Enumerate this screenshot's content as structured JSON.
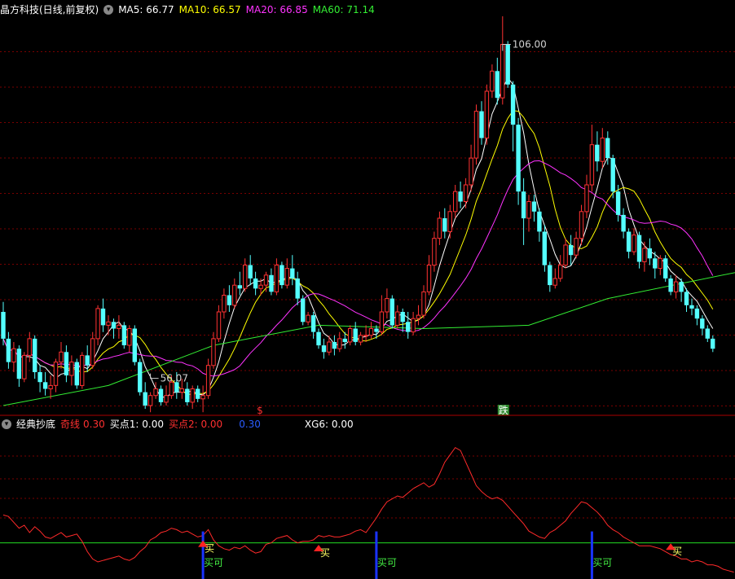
{
  "top": {
    "title": "晶方科技(日线,前复权)",
    "indicators": [
      {
        "label": "MA5: 66.77",
        "color": "#ffffff"
      },
      {
        "label": "MA10: 66.57",
        "color": "#ffff00"
      },
      {
        "label": "MA20: 66.85",
        "color": "#ff33ff"
      },
      {
        "label": "MA60: 71.14",
        "color": "#33ee33"
      }
    ]
  },
  "bottom": {
    "title": "经典抄底",
    "indicators": [
      {
        "label": "奇线",
        "color": "#ff3030"
      },
      {
        "label": "0.30",
        "color": "#ff3030"
      },
      {
        "label": "买点1: 0.00",
        "color": "#ffffff"
      },
      {
        "label": "买点2: 0.00",
        "color": "#ff3030"
      },
      {
        "label": "0.30",
        "color": "#2a5cff"
      },
      {
        "label": "XG6: 0.00",
        "color": "#ffffff"
      }
    ]
  },
  "chart_data": [
    {
      "type": "candlestick",
      "high_label": "106.00",
      "low_label": "56.07",
      "high_value": 106.0,
      "low_value": 56.07,
      "ylim": [
        52.0,
        110.2
      ],
      "bars": [
        [
          66.0,
          62.0,
          67.5,
          61.0
        ],
        [
          62.0,
          58.5,
          63.0,
          57.5
        ],
        [
          58.5,
          60.5,
          61.5,
          57.0
        ],
        [
          60.5,
          56.0,
          61.0,
          54.8
        ],
        [
          56.0,
          59.5,
          60.0,
          55.5
        ],
        [
          59.5,
          62.0,
          63.0,
          58.5
        ],
        [
          62.0,
          57.0,
          62.5,
          56.0
        ],
        [
          57.0,
          55.5,
          58.0,
          54.0
        ],
        [
          55.5,
          54.5,
          57.0,
          53.5
        ],
        [
          54.5,
          55.0,
          56.5,
          53.0
        ],
        [
          55.0,
          58.5,
          59.0,
          54.0
        ],
        [
          58.5,
          60.0,
          61.5,
          57.5
        ],
        [
          60.0,
          56.5,
          61.0,
          55.5
        ],
        [
          56.5,
          58.5,
          59.5,
          55.0
        ],
        [
          58.5,
          55.0,
          59.0,
          54.5
        ],
        [
          55.0,
          59.5,
          60.0,
          54.5
        ],
        [
          59.5,
          58.0,
          61.0,
          57.0
        ],
        [
          58.0,
          62.0,
          63.0,
          57.5
        ],
        [
          62.0,
          66.5,
          67.0,
          61.0
        ],
        [
          66.5,
          64.0,
          68.0,
          63.0
        ],
        [
          64.0,
          64.5,
          65.5,
          62.5
        ],
        [
          64.5,
          63.5,
          65.0,
          62.0
        ],
        [
          63.5,
          64.0,
          65.5,
          62.0
        ],
        [
          64.0,
          61.0,
          64.5,
          60.5
        ],
        [
          61.0,
          63.5,
          64.0,
          60.0
        ],
        [
          63.5,
          58.5,
          64.0,
          58.0
        ],
        [
          58.5,
          54.0,
          59.0,
          53.5
        ],
        [
          54.0,
          52.0,
          55.5,
          51.5
        ],
        [
          52.0,
          53.5,
          54.0,
          51.0
        ],
        [
          53.5,
          54.5,
          55.5,
          53.0
        ],
        [
          54.5,
          52.5,
          55.0,
          52.0
        ],
        [
          52.5,
          53.5,
          55.0,
          52.0
        ],
        [
          53.5,
          55.5,
          56.5,
          53.0
        ],
        [
          55.5,
          54.0,
          57.0,
          53.0
        ],
        [
          54.0,
          54.5,
          56.0,
          53.0
        ],
        [
          54.5,
          52.5,
          55.5,
          52.0
        ],
        [
          52.5,
          54.5,
          55.0,
          51.5
        ],
        [
          54.5,
          53.0,
          55.0,
          52.5
        ],
        [
          53.0,
          53.5,
          55.0,
          51.0
        ],
        [
          53.5,
          58.0,
          59.0,
          53.0
        ],
        [
          58.0,
          62.0,
          63.0,
          57.5
        ],
        [
          62.0,
          66.0,
          67.0,
          61.5
        ],
        [
          66.0,
          68.5,
          69.5,
          65.0
        ],
        [
          68.5,
          67.0,
          70.0,
          66.0
        ],
        [
          67.0,
          70.0,
          71.0,
          66.5
        ],
        [
          70.0,
          69.5,
          72.0,
          68.5
        ],
        [
          69.5,
          73.0,
          74.0,
          69.0
        ],
        [
          73.0,
          71.0,
          74.5,
          70.0
        ],
        [
          71.0,
          69.5,
          72.0,
          68.5
        ],
        [
          69.5,
          70.0,
          71.0,
          68.5
        ],
        [
          70.0,
          71.5,
          72.0,
          69.0
        ],
        [
          71.5,
          69.0,
          72.5,
          68.5
        ],
        [
          69.0,
          73.0,
          74.0,
          68.5
        ],
        [
          73.0,
          70.0,
          73.5,
          69.5
        ],
        [
          70.0,
          72.5,
          74.0,
          69.5
        ],
        [
          72.5,
          71.0,
          74.5,
          70.0
        ],
        [
          71.0,
          68.0,
          72.0,
          67.0
        ],
        [
          68.0,
          64.5,
          68.5,
          64.0
        ],
        [
          64.5,
          65.5,
          66.0,
          64.0
        ],
        [
          65.5,
          63.0,
          66.0,
          62.0
        ],
        [
          63.0,
          61.0,
          63.5,
          60.5
        ],
        [
          61.0,
          60.0,
          62.0,
          59.0
        ],
        [
          60.0,
          61.5,
          62.5,
          59.5
        ],
        [
          61.5,
          60.5,
          62.5,
          59.5
        ],
        [
          60.5,
          62.0,
          63.0,
          60.0
        ],
        [
          62.0,
          61.5,
          63.0,
          60.5
        ],
        [
          61.5,
          63.5,
          64.0,
          61.0
        ],
        [
          63.5,
          61.5,
          64.5,
          61.0
        ],
        [
          61.5,
          62.5,
          63.0,
          61.0
        ],
        [
          62.5,
          62.5,
          64.0,
          61.5
        ],
        [
          62.5,
          63.5,
          64.5,
          62.0
        ],
        [
          63.5,
          63.0,
          64.0,
          62.0
        ],
        [
          63.0,
          66.0,
          68.5,
          62.5
        ],
        [
          66.0,
          68.0,
          69.5,
          65.0
        ],
        [
          68.0,
          64.0,
          68.5,
          63.5
        ],
        [
          64.0,
          66.0,
          67.0,
          63.5
        ],
        [
          66.0,
          64.5,
          66.5,
          63.0
        ],
        [
          64.5,
          63.0,
          66.0,
          62.0
        ],
        [
          63.0,
          65.0,
          66.0,
          62.5
        ],
        [
          65.0,
          65.5,
          67.0,
          64.0
        ],
        [
          65.5,
          69.0,
          70.0,
          65.0
        ],
        [
          69.0,
          73.0,
          74.5,
          68.5
        ],
        [
          73.0,
          77.0,
          78.0,
          72.0
        ],
        [
          77.0,
          80.0,
          81.0,
          76.0
        ],
        [
          80.0,
          78.0,
          81.5,
          77.0
        ],
        [
          78.0,
          81.0,
          82.0,
          77.0
        ],
        [
          81.0,
          84.0,
          85.0,
          80.0
        ],
        [
          84.0,
          82.5,
          85.5,
          81.5
        ],
        [
          82.5,
          85.0,
          86.0,
          81.5
        ],
        [
          85.0,
          89.0,
          91.0,
          84.0
        ],
        [
          89.0,
          96.0,
          97.0,
          88.0
        ],
        [
          96.0,
          92.0,
          97.5,
          91.0
        ],
        [
          92.0,
          99.0,
          100.0,
          91.0
        ],
        [
          99.0,
          102.0,
          103.0,
          98.0
        ],
        [
          102.0,
          98.0,
          104.0,
          97.0
        ],
        [
          98.0,
          106.0,
          110.2,
          97.0
        ],
        [
          106.0,
          100.0,
          106.5,
          99.5
        ],
        [
          100.0,
          94.0,
          100.5,
          90.0
        ],
        [
          94.0,
          84.0,
          95.0,
          82.0
        ],
        [
          84.0,
          80.0,
          86.0,
          76.0
        ],
        [
          80.0,
          82.5,
          83.5,
          78.0
        ],
        [
          82.5,
          81.0,
          83.5,
          79.5
        ],
        [
          81.0,
          78.0,
          81.5,
          76.5
        ],
        [
          78.0,
          73.0,
          79.0,
          72.0
        ],
        [
          73.0,
          70.0,
          73.5,
          69.0
        ],
        [
          70.0,
          71.0,
          72.5,
          69.5
        ],
        [
          71.0,
          73.0,
          74.5,
          70.5
        ],
        [
          73.0,
          76.0,
          77.0,
          72.5
        ],
        [
          76.0,
          74.5,
          77.5,
          73.0
        ],
        [
          74.5,
          77.0,
          78.0,
          74.0
        ],
        [
          77.0,
          81.0,
          82.0,
          76.0
        ],
        [
          81.0,
          85.0,
          86.5,
          80.0
        ],
        [
          85.0,
          91.0,
          94.0,
          84.0
        ],
        [
          91.0,
          88.5,
          93.0,
          87.0
        ],
        [
          88.5,
          92.0,
          93.5,
          87.5
        ],
        [
          92.0,
          89.0,
          93.0,
          88.0
        ],
        [
          89.0,
          84.0,
          89.5,
          83.0
        ],
        [
          84.0,
          80.5,
          85.0,
          79.5
        ],
        [
          80.5,
          78.0,
          81.5,
          77.0
        ],
        [
          78.0,
          75.0,
          78.5,
          74.0
        ],
        [
          75.0,
          77.5,
          78.5,
          74.5
        ],
        [
          77.5,
          73.5,
          78.0,
          72.5
        ],
        [
          73.5,
          75.5,
          76.5,
          72.0
        ],
        [
          75.5,
          74.0,
          77.0,
          73.0
        ],
        [
          74.0,
          72.5,
          75.0,
          71.0
        ],
        [
          72.5,
          74.0,
          74.5,
          71.5
        ],
        [
          74.0,
          71.0,
          74.5,
          70.5
        ],
        [
          71.0,
          69.0,
          71.5,
          68.5
        ],
        [
          69.0,
          70.5,
          71.5,
          68.0
        ],
        [
          70.5,
          69.0,
          71.0,
          67.5
        ],
        [
          69.0,
          67.0,
          69.5,
          66.0
        ],
        [
          67.0,
          66.5,
          68.0,
          65.5
        ],
        [
          66.5,
          65.0,
          67.0,
          64.0
        ],
        [
          65.0,
          63.5,
          65.5,
          62.5
        ],
        [
          63.5,
          62.0,
          64.0,
          61.5
        ],
        [
          62.0,
          60.5,
          62.5,
          60.0
        ]
      ],
      "ma_labels": [
        "MA5",
        "MA10",
        "MA20",
        "MA60"
      ],
      "ma_colors": [
        "#ffffff",
        "#ffff00",
        "#ff33ff",
        "#33ee33"
      ],
      "ma60": [
        [
          0,
          52.0
        ],
        [
          20,
          55.0
        ],
        [
          40,
          61.0
        ],
        [
          60,
          64.0
        ],
        [
          80,
          63.5
        ],
        [
          100,
          64.0
        ],
        [
          115,
          68.0
        ],
        [
          140,
          72.0
        ]
      ],
      "markers": [
        {
          "text": "$",
          "bar": 49,
          "color": "#ff3030"
        },
        {
          "text": "跌",
          "bar": 95,
          "color": "#ffffff",
          "bg": "#2d8a2d"
        }
      ]
    },
    {
      "type": "line",
      "ylim": [
        0,
        100
      ],
      "values": [
        42,
        41,
        37,
        33,
        35,
        30,
        34,
        31,
        27,
        26,
        28,
        30,
        27,
        28,
        29,
        24,
        17,
        12,
        10,
        11,
        12,
        13,
        14,
        12,
        11,
        13,
        17,
        20,
        25,
        27,
        30,
        31,
        33,
        32,
        30,
        31,
        29,
        27,
        28,
        32,
        25,
        21,
        19,
        18,
        20,
        19,
        21,
        18,
        16,
        17,
        22,
        23,
        26,
        27,
        28,
        25,
        23,
        24,
        24,
        25,
        28,
        27,
        28,
        27,
        27,
        28,
        29,
        31,
        32,
        30,
        35,
        40,
        46,
        51,
        53,
        55,
        54,
        57,
        60,
        62,
        64,
        61,
        63,
        70,
        78,
        83,
        88,
        86,
        78,
        70,
        62,
        58,
        55,
        53,
        54,
        52,
        48,
        44,
        40,
        36,
        31,
        29,
        27,
        26,
        30,
        32,
        35,
        38,
        43,
        47,
        51,
        50,
        47,
        44,
        40,
        35,
        32,
        30,
        27,
        25,
        23,
        21,
        21,
        21,
        20,
        19,
        17,
        15,
        14,
        12,
        12,
        10,
        11,
        10,
        8,
        8,
        7,
        5,
        4,
        3
      ],
      "zero_value": 23,
      "buy_signals": [
        {
          "bar": 38,
          "label": "买",
          "value": 23
        },
        {
          "bar": 60,
          "label": "买",
          "value": 20
        },
        {
          "bar": 127,
          "label": "买",
          "value": 21
        }
      ],
      "vertical_signals": [
        {
          "bar": 38,
          "label": "买可"
        },
        {
          "bar": 71,
          "label": "买可"
        },
        {
          "bar": 112,
          "label": "买可"
        }
      ]
    }
  ]
}
